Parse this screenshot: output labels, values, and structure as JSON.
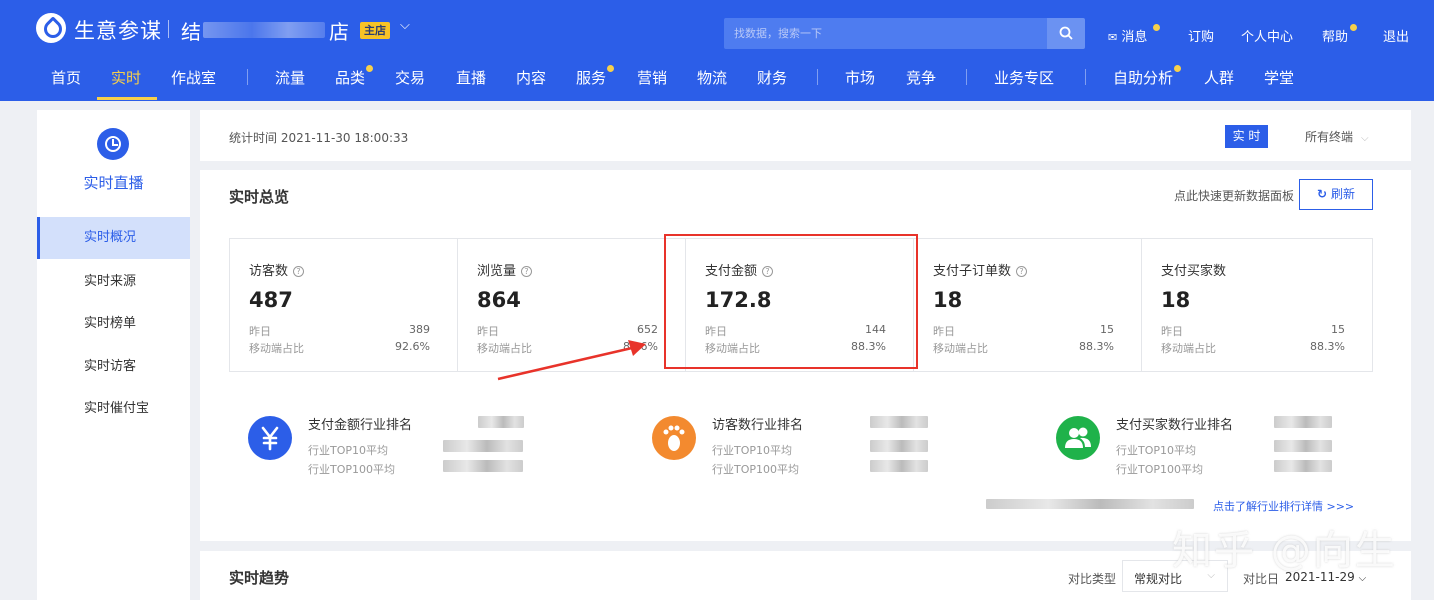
{
  "header": {
    "brand": "生意参谋",
    "shop_name_start": "结",
    "shop_name_end": "店",
    "shop_badge": "主店",
    "search_placeholder": "找数据，搜索一下",
    "top_links": [
      "消息",
      "订购",
      "个人中心",
      "帮助",
      "退出"
    ],
    "nav": [
      "首页",
      "实时",
      "作战室",
      "流量",
      "品类",
      "交易",
      "直播",
      "内容",
      "服务",
      "营销",
      "物流",
      "财务",
      "市场",
      "竞争",
      "业务专区",
      "自助分析",
      "人群",
      "学堂"
    ],
    "active_nav": "实时",
    "accent": "#2c5ee8",
    "dot_color": "#f7d04a"
  },
  "sidebar": {
    "title": "实时直播",
    "icon": "clock-icon",
    "items": [
      "实时概况",
      "实时来源",
      "实时榜单",
      "实时访客",
      "实时催付宝"
    ],
    "active": "实时概况"
  },
  "status_bar": {
    "time_label": "统计时间 2021-11-30 18:00:33",
    "realtime_button": "实 时",
    "terminal": "所有终端"
  },
  "overview": {
    "title": "实时总览",
    "refresh_hint": "点此快速更新数据面板",
    "refresh_button": "刷新",
    "metrics": [
      {
        "label": "访客数",
        "value": "487",
        "yesterday_label": "昨日",
        "yesterday": "389",
        "mobile_label": "移动端占比",
        "mobile": "92.6%"
      },
      {
        "label": "浏览量",
        "value": "864",
        "yesterday_label": "昨日",
        "yesterday": "652",
        "mobile_label": "移动端占比",
        "mobile": "88.6%"
      },
      {
        "label": "支付金额",
        "value": "172.8",
        "yesterday_label": "昨日",
        "yesterday": "144",
        "mobile_label": "移动端占比",
        "mobile": "88.3%"
      },
      {
        "label": "支付子订单数",
        "value": "18",
        "yesterday_label": "昨日",
        "yesterday": "15",
        "mobile_label": "移动端占比",
        "mobile": "88.3%"
      },
      {
        "label": "支付买家数",
        "value": "18",
        "yesterday_label": "昨日",
        "yesterday": "15",
        "mobile_label": "移动端占比",
        "mobile": "88.3%"
      }
    ],
    "rankings": [
      {
        "title": "支付金额行业排名",
        "top10": "行业TOP10平均",
        "top100": "行业TOP100平均",
        "icon": "yen-icon",
        "color": "#2c5ee8"
      },
      {
        "title": "访客数行业排名",
        "top10": "行业TOP10平均",
        "top100": "行业TOP100平均",
        "icon": "footprint-icon",
        "color": "#f38a2f"
      },
      {
        "title": "支付买家数行业排名",
        "top10": "行业TOP10平均",
        "top100": "行业TOP100平均",
        "icon": "users-icon",
        "color": "#1fb24a"
      }
    ],
    "ranking_link": "点击了解行业排行详情 >>>"
  },
  "trend": {
    "title": "实时趋势",
    "compare_type_label": "对比类型",
    "compare_type_value": "常规对比",
    "compare_date_label": "对比日",
    "compare_date_value": "2021-11-29"
  },
  "watermark": "知乎 @向生",
  "highlight_color": "#e8332a"
}
